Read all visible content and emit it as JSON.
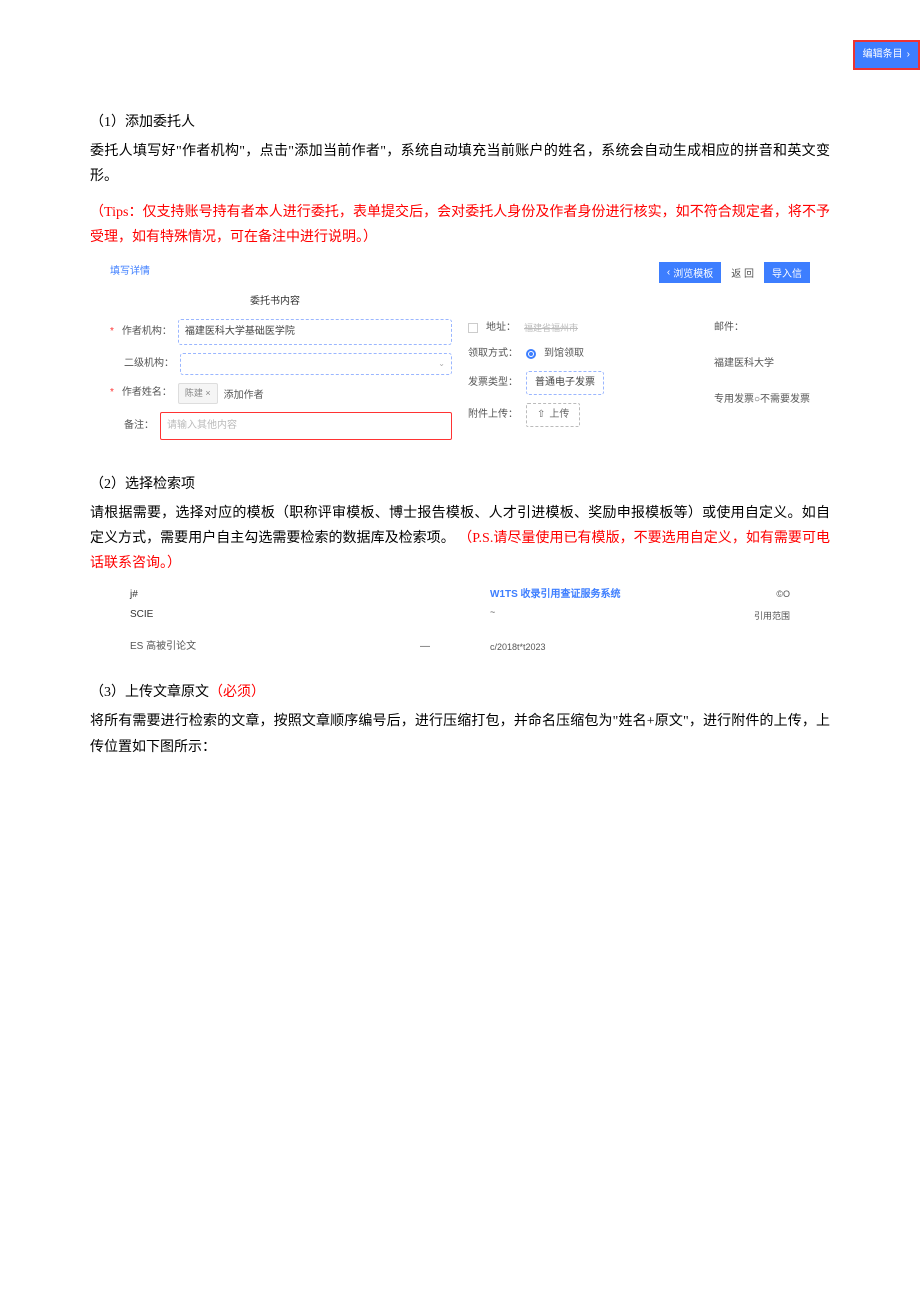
{
  "topButton": {
    "label": "编辑条目"
  },
  "section1": {
    "heading": "（1）添加委托人",
    "para1": "委托人填写好\"作者机构\"，点击\"添加当前作者\"，系统自动填充当前账户的姓名，系统会自动生成相应的拼音和英文变形。",
    "tip": "（Tips：仅支持账号持有者本人进行委托，表单提交后，会对委托人身份及作者身份进行核实，如不符合规定者，将不予受理，如有特殊情况，可在备注中进行说明。）"
  },
  "form1": {
    "detailsLink": "填写详情",
    "btnBrowse": "浏览模板",
    "btnReturn": "返 回",
    "btnImport": "导入信",
    "title": "委托书内容",
    "labels": {
      "authorOrg": "作者机构：",
      "secondOrg": "二级机构：",
      "authorName": "作者姓名：",
      "remark": "备注：",
      "address": "地址：",
      "receiveMethod": "领取方式：",
      "invoiceType": "发票类型：",
      "attachment": "附件上传：",
      "email": "邮件：",
      "specialInvoice": "专用发票",
      "noInvoice": "不需要发票"
    },
    "values": {
      "authorOrg": "福建医科大学基础医学院",
      "nameChip": "陈建 ×",
      "addAuthor": "添加作者",
      "remarkPlaceholder": "请输入其他内容",
      "addressGray": "福建省福州市",
      "receiveOption": "到馆领取",
      "invoiceOption": "普通电子发票",
      "uploadBtn": "上传",
      "orgShort": "福建医科大学"
    }
  },
  "section2": {
    "heading": "（2）选择检索项",
    "para1a": "请根据需要，选择对应的模板（职称评审模板、博士报告模板、人才引进模板、奖励申报模板等）或使用自定义。如自定义方式，需要用户自主勾选需要检索的数据库及检索项。 ",
    "para1b": "（P.S.请尽量使用已有模版，不要选用自定义，如有需要可电话联系咨询。）"
  },
  "figure2": {
    "jhash": "j#",
    "scie": "SCIE",
    "esThesis": "ES 高被引论文",
    "dash": "—",
    "systemName": "W1TS 收录引用查证服务系统",
    "citeRange": "引用范围",
    "dateRange": "c/2018t*t2023",
    "copyright": "©O"
  },
  "section3": {
    "heading_a": "（3）上传文章原文",
    "heading_b": "（必须）",
    "para1": "将所有需要进行检索的文章，按照文章顺序编号后，进行压缩打包，并命名压缩包为\"姓名+原文\"，进行附件的上传，上传位置如下图所示："
  }
}
